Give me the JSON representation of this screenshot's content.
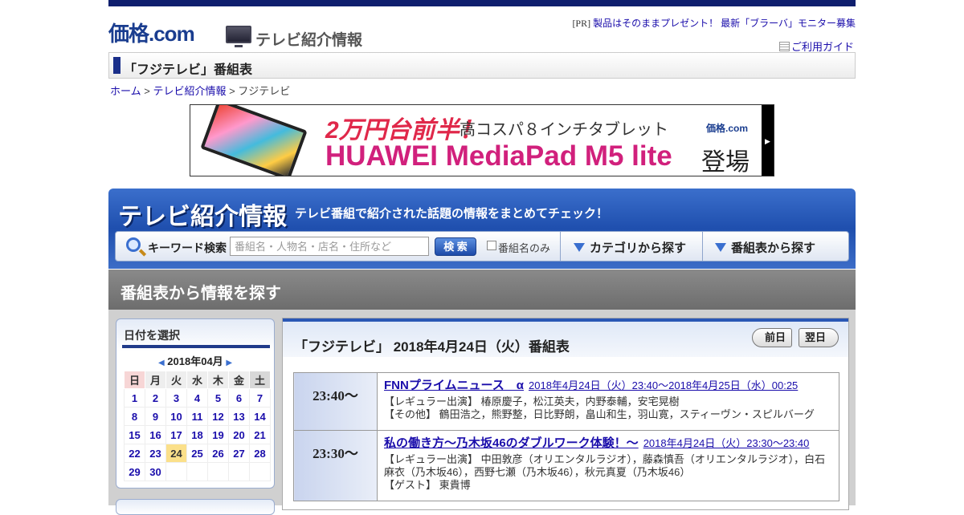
{
  "header": {
    "logo": "価格.com",
    "service_name": "テレビ紹介情報",
    "pr_prefix": "[PR]",
    "pr_text": "製品はそのままプレゼント！ 最新「ブラーバ」モニター募集",
    "guide_label": "ご利用ガイド"
  },
  "page_title": "「フジテレビ」番組表",
  "breadcrumb": {
    "home": "ホーム",
    "sep1": " > ",
    "tv_info": "テレビ紹介情報",
    "sep2": " > ",
    "current": "フジテレビ"
  },
  "banner": {
    "line1_price": "2万円台前半！",
    "line1_desc": "高コスパ８インチタブレット",
    "logo": "価格.com",
    "line2_product": "HUAWEI MediaPad M5 lite",
    "line2_suffix": "登場",
    "arrow": "▶"
  },
  "tv_header": {
    "title": "テレビ紹介情報",
    "subtitle": "テレビ番組で紹介された話題の情報をまとめてチェック！"
  },
  "search": {
    "label": "キーワード検索",
    "placeholder": "番組名・人物名・店名・住所など",
    "button": "検 索",
    "checkbox_label": "番組名のみ",
    "tab_category": "カテゴリから探す",
    "tab_schedule": "番組表から探す"
  },
  "section_title": "番組表から情報を探す",
  "calendar": {
    "title": "日付を選択",
    "month": "2018年04月",
    "weekdays": [
      "日",
      "月",
      "火",
      "水",
      "木",
      "金",
      "土"
    ],
    "weeks": [
      [
        "1",
        "2",
        "3",
        "4",
        "5",
        "6",
        "7"
      ],
      [
        "8",
        "9",
        "10",
        "11",
        "12",
        "13",
        "14"
      ],
      [
        "15",
        "16",
        "17",
        "18",
        "19",
        "20",
        "21"
      ],
      [
        "22",
        "23",
        "24",
        "25",
        "26",
        "27",
        "28"
      ],
      [
        "29",
        "30",
        "",
        "",
        "",
        "",
        ""
      ]
    ],
    "selected": "24"
  },
  "schedule": {
    "title": "「フジテレビ」 2018年4月24日（火）番組表",
    "prev": "前日",
    "next": "翌日",
    "programs": [
      {
        "time": "23:40～",
        "title": "FNNプライムニュース　α",
        "datetime": "2018年4月24日（火）23:40～2018年4月25日（水）00:25",
        "cast": [
          "【レギュラー出演】 椿原慶子，松江英夫，内野泰輔，安宅晃樹",
          "【その他】 鶴田浩之，熊野整，日比野朗，畠山和生，羽山寛，スティーヴン・スピルバーグ"
        ]
      },
      {
        "time": "23:30～",
        "title": "私の働き方～乃木坂46のダブルワーク体験！～",
        "datetime": "2018年4月24日（火）23:30～23:40",
        "cast": [
          "【レギュラー出演】 中田敦彦（オリエンタルラジオ），藤森慎吾（オリエンタルラジオ），白石麻衣（乃木坂46），西野七瀬（乃木坂46），秋元真夏（乃木坂46）",
          "【ゲスト】 東貴博"
        ]
      }
    ]
  }
}
